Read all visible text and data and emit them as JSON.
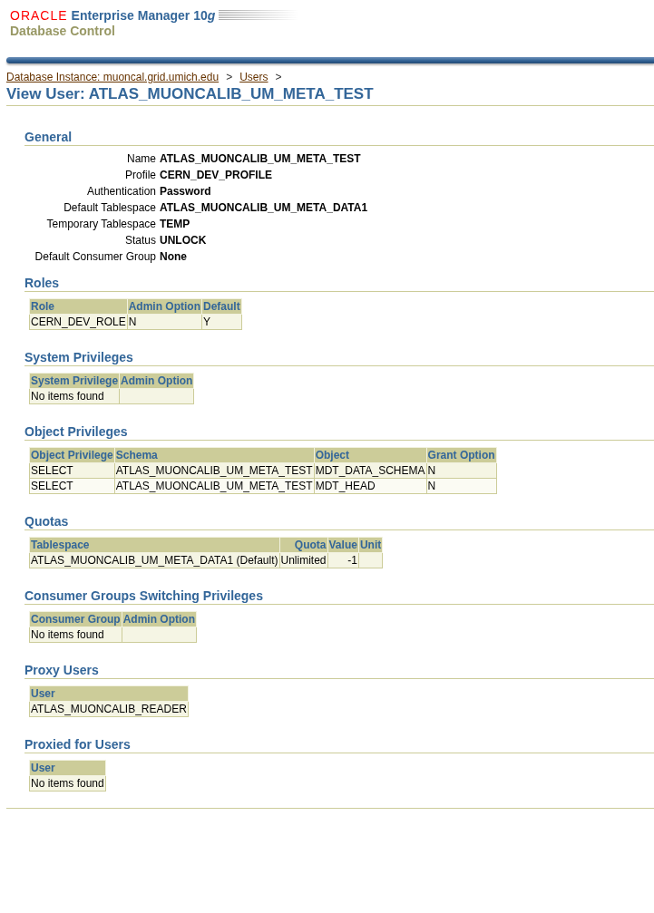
{
  "branding": {
    "vendor": "ORACLE",
    "product": "Enterprise Manager 10",
    "version_suffix": "g",
    "subtitle": "Database Control"
  },
  "breadcrumb": [
    {
      "label": "Database Instance: muoncal.grid.umich.edu"
    },
    {
      "label": "Users"
    }
  ],
  "breadcrumb_separator": ">",
  "page_title": "View User: ATLAS_MUONCALIB_UM_META_TEST",
  "general": {
    "title": "General",
    "fields": [
      {
        "label": "Name",
        "value": "ATLAS_MUONCALIB_UM_META_TEST"
      },
      {
        "label": "Profile",
        "value": "CERN_DEV_PROFILE"
      },
      {
        "label": "Authentication",
        "value": "Password"
      },
      {
        "label": "Default Tablespace",
        "value": "ATLAS_MUONCALIB_UM_META_DATA1"
      },
      {
        "label": "Temporary Tablespace",
        "value": "TEMP"
      },
      {
        "label": "Status",
        "value": "UNLOCK"
      },
      {
        "label": "Default Consumer Group",
        "value": "None"
      }
    ]
  },
  "sections": [
    {
      "title": "Roles",
      "columns": [
        {
          "label": "Role",
          "kind": "text"
        },
        {
          "label": "Admin Option",
          "kind": "text"
        },
        {
          "label": "Default",
          "kind": "text"
        }
      ],
      "rows": [
        [
          "CERN_DEV_ROLE",
          "N",
          "Y"
        ]
      ]
    },
    {
      "title": "System Privileges",
      "columns": [
        {
          "label": "System Privilege",
          "kind": "text"
        },
        {
          "label": "Admin Option",
          "kind": "text"
        }
      ],
      "rows": [
        [
          "No items found",
          ""
        ]
      ]
    },
    {
      "title": "Object Privileges",
      "columns": [
        {
          "label": "Object Privilege",
          "kind": "text"
        },
        {
          "label": "Schema",
          "kind": "text"
        },
        {
          "label": "Object",
          "kind": "text"
        },
        {
          "label": "Grant Option",
          "kind": "text"
        }
      ],
      "rows": [
        [
          "SELECT",
          "ATLAS_MUONCALIB_UM_META_TEST",
          "MDT_DATA_SCHEMA",
          "N"
        ],
        [
          "SELECT",
          "ATLAS_MUONCALIB_UM_META_TEST",
          "MDT_HEAD",
          "N"
        ]
      ]
    },
    {
      "title": "Quotas",
      "columns": [
        {
          "label": "Tablespace",
          "kind": "text"
        },
        {
          "label": "Quota",
          "kind": "number"
        },
        {
          "label": "Value",
          "kind": "number"
        },
        {
          "label": "Unit",
          "kind": "text"
        }
      ],
      "rows": [
        [
          "ATLAS_MUONCALIB_UM_META_DATA1 (Default)",
          "Unlimited",
          "-1",
          ""
        ]
      ]
    },
    {
      "title": "Consumer Groups Switching Privileges",
      "columns": [
        {
          "label": "Consumer Group",
          "kind": "text"
        },
        {
          "label": "Admin Option",
          "kind": "text"
        }
      ],
      "rows": [
        [
          "No items found",
          ""
        ]
      ]
    },
    {
      "title": "Proxy Users",
      "columns": [
        {
          "label": "User",
          "kind": "text"
        }
      ],
      "rows": [
        [
          "ATLAS_MUONCALIB_READER"
        ]
      ]
    },
    {
      "title": "Proxied for Users",
      "columns": [
        {
          "label": "User",
          "kind": "text"
        }
      ],
      "rows": [
        [
          "No items found"
        ]
      ]
    }
  ]
}
